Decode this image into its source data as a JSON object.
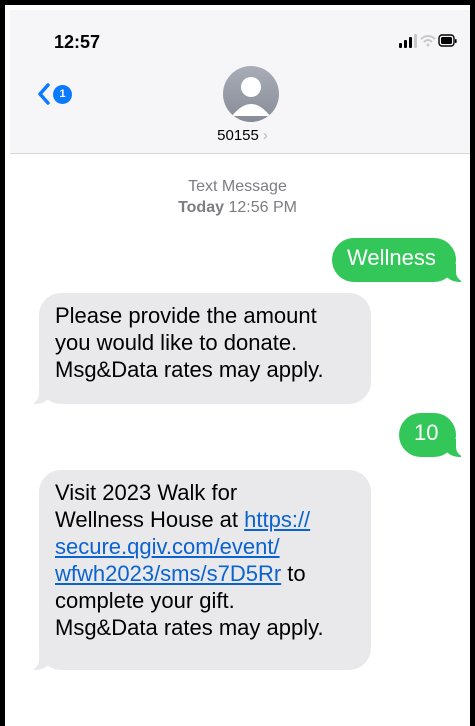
{
  "status_bar": {
    "time": "12:57"
  },
  "header": {
    "back_badge_count": "1",
    "contact_name": "50155",
    "contact_chevron": "›"
  },
  "thread": {
    "service_label": "Text Message",
    "date_label": "Today",
    "time_label": "12:56 PM"
  },
  "messages": [
    {
      "direction": "outgoing",
      "text": "Wellness"
    },
    {
      "direction": "incoming",
      "lines": [
        "Please provide the amount",
        "you would like to donate.",
        "Msg&Data rates may apply."
      ]
    },
    {
      "direction": "outgoing",
      "text": "10"
    },
    {
      "direction": "incoming",
      "line1": "Visit 2023 Walk for",
      "line2_prefix": "Wellness House at ",
      "link_line1": "https://",
      "link_line2": "secure.qgiv.com/event/",
      "link_line3": "wfwh2023/sms/s7D5Rr",
      "after_link": " to",
      "line5": "complete your gift.",
      "line6": "Msg&Data rates may apply."
    }
  ],
  "colors": {
    "accent_blue": "#0a7aff",
    "sent_green": "#33c759",
    "received_gray": "#e9e9eb",
    "link": "#0a63d1"
  }
}
